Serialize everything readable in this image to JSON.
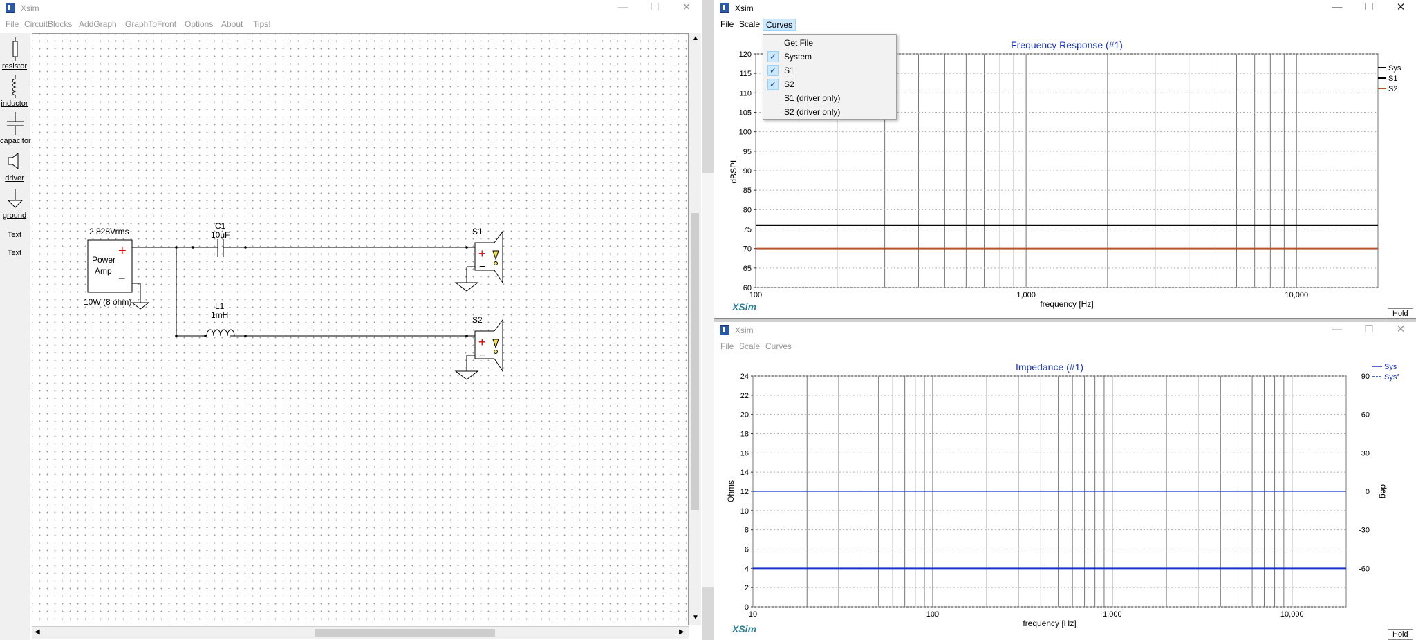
{
  "schematic": {
    "title": "Xsim",
    "menu": [
      "File",
      "CircuitBlocks",
      "AddGraph",
      "GraphToFront",
      "Options",
      "About",
      "Tips!"
    ],
    "palette": [
      {
        "label": "resistor",
        "icon": "resistor-icon"
      },
      {
        "label": "inductor",
        "icon": "inductor-icon"
      },
      {
        "label": "capacitor",
        "icon": "capacitor-icon"
      },
      {
        "label": "driver",
        "icon": "driver-icon"
      },
      {
        "label": "ground",
        "icon": "ground-icon"
      },
      {
        "label": "Text",
        "icon": "text-tool"
      },
      {
        "label": "Text",
        "icon": "text-tool"
      }
    ],
    "amp": {
      "voltage": "2.828Vrms",
      "name_line1": "Power",
      "name_line2": "Amp",
      "power": "10W (8 ohm)",
      "plus": "+",
      "minus": "−"
    },
    "c1": {
      "name": "C1",
      "value": "10uF"
    },
    "l1": {
      "name": "L1",
      "value": "1mH"
    },
    "s1": {
      "name": "S1"
    },
    "s2": {
      "name": "S2"
    }
  },
  "freq_window": {
    "title": "Xsim",
    "menu": [
      "File",
      "Scale",
      "Curves"
    ],
    "open_menu": "Curves",
    "dropdown": [
      {
        "label": "Get File",
        "checked": false
      },
      {
        "label": "System",
        "checked": true
      },
      {
        "label": "S1",
        "checked": true
      },
      {
        "label": "S2",
        "checked": true
      },
      {
        "label": "S1 (driver only)",
        "checked": false
      },
      {
        "label": "S2 (driver only)",
        "checked": false
      }
    ],
    "check_glyph": "✓",
    "logo": "XSim",
    "hold": "Hold"
  },
  "imp_window": {
    "title": "Xsim",
    "menu": [
      "File",
      "Scale",
      "Curves"
    ],
    "logo": "XSim",
    "hold": "Hold"
  },
  "chart_data": [
    {
      "type": "line",
      "title": "Frequency Response (#1)",
      "xlabel": "frequency [Hz]",
      "ylabel": "dBSPL",
      "x_scale": "log",
      "xlim": [
        100,
        20000
      ],
      "ylim": [
        60,
        120
      ],
      "y_ticks": [
        60,
        65,
        70,
        75,
        80,
        85,
        90,
        95,
        100,
        105,
        110,
        115,
        120
      ],
      "x_tick_labels": [
        {
          "x": 100,
          "label": "100"
        },
        {
          "x": 1000,
          "label": "1,000"
        },
        {
          "x": 10000,
          "label": "10,000"
        }
      ],
      "grid": true,
      "legend_position": "right",
      "series": [
        {
          "name": "Sys",
          "color": "#000000",
          "x": [
            100,
            20000
          ],
          "y": [
            76,
            76
          ]
        },
        {
          "name": "S1",
          "color": "#000000",
          "x": [
            100,
            20000
          ],
          "y": [
            76,
            76
          ]
        },
        {
          "name": "S2",
          "color": "#b5532c",
          "x": [
            100,
            20000
          ],
          "y": [
            70,
            70
          ]
        }
      ]
    },
    {
      "type": "line",
      "title": "Impedance (#1)",
      "xlabel": "frequency [Hz]",
      "ylabel": "Ohms",
      "y2label": "deg",
      "x_scale": "log",
      "xlim": [
        10,
        20000
      ],
      "ylim": [
        0,
        24
      ],
      "y2lim": [
        -90,
        90
      ],
      "y_ticks": [
        0,
        2,
        4,
        6,
        8,
        10,
        12,
        14,
        16,
        18,
        20,
        22,
        24
      ],
      "y2_ticks": [
        -60,
        -30,
        0,
        30,
        60,
        90
      ],
      "x_tick_labels": [
        {
          "x": 10,
          "label": "10"
        },
        {
          "x": 100,
          "label": "100"
        },
        {
          "x": 1000,
          "label": "1,000"
        },
        {
          "x": 10000,
          "label": "10,000"
        }
      ],
      "grid": true,
      "legend_position": "top-right",
      "series": [
        {
          "name": "Sys",
          "color": "#1a33cc",
          "style": "solid",
          "axis": "left",
          "x": [
            10,
            20000
          ],
          "y": [
            4,
            4
          ]
        },
        {
          "name": "Sys°",
          "color": "#1a33cc",
          "style": "dashed",
          "axis": "right",
          "x": [
            10,
            20000
          ],
          "y": [
            0,
            0
          ]
        }
      ]
    }
  ]
}
